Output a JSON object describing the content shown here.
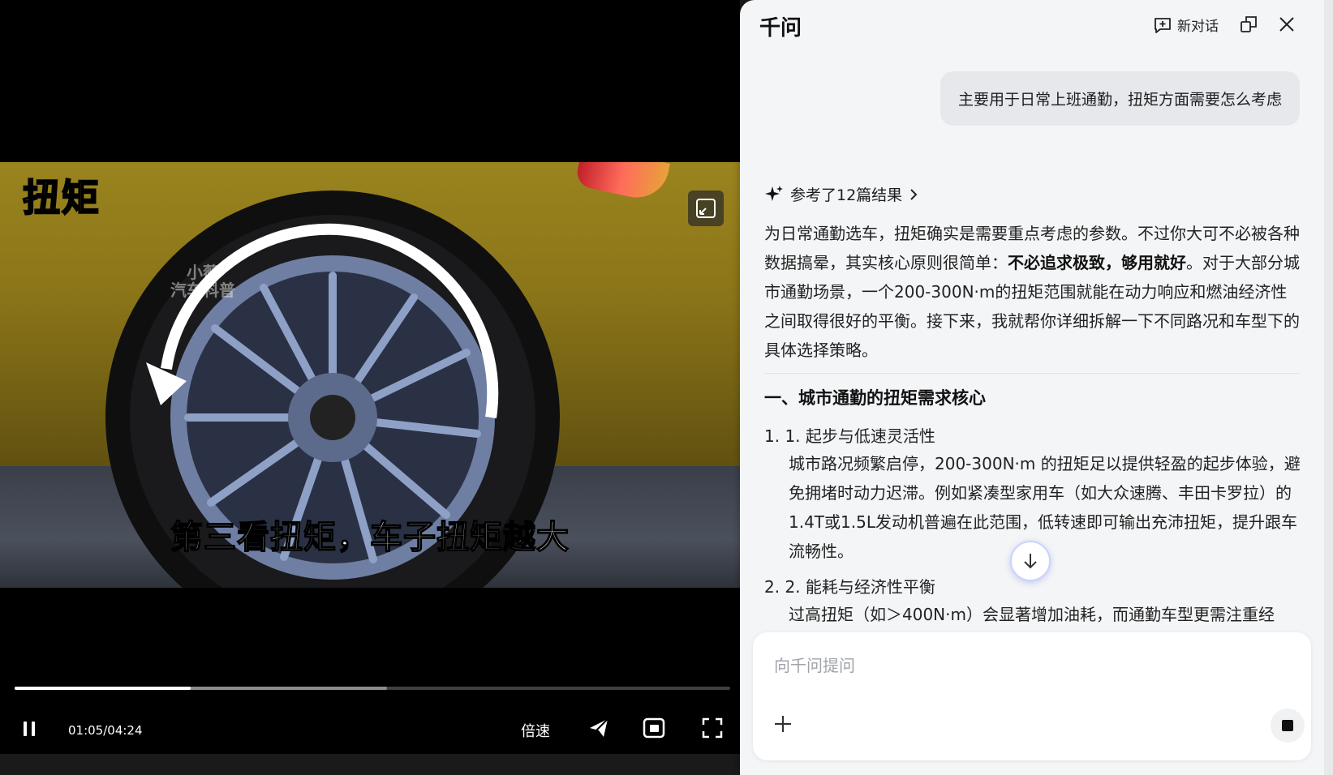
{
  "video": {
    "overlay_tag": "扭矩",
    "watermark_line1": "小薇",
    "watermark_line2": "汽车科普",
    "subtitle": "第三看扭矩，车子扭矩越大",
    "time_display": "01:05/04:24",
    "speed_label": "倍速",
    "played_fraction": 0.246,
    "loaded_fraction": 0.52,
    "icons": [
      "pause-icon",
      "share-icon",
      "mini-player-icon",
      "fullscreen-icon",
      "pip-expand-icon"
    ]
  },
  "chat": {
    "app_title": "千问",
    "new_chat_label": "新对话",
    "user_message": "主要用于日常上班通勤，扭矩方面需要怎么考虑",
    "refs_label": "参考了12篇结果",
    "answer": {
      "p1_a": "为日常通勤选车，扭矩确实是需要重点考虑的参数。不过你大可不必被各种数据搞晕，其实核心原则很简单：",
      "p1_bold": "不必追求极致，够用就好",
      "p1_b": "。对于大部分城市通勤场景，一个200-300N·m的扭矩范围就能在动力响应和燃油经济性之间取得很好的平衡。接下来，我就帮你详细拆解一下不同路况和车型下的具体选择策略。"
    },
    "section_title": "一、城市通勤的扭矩需求核心",
    "items": [
      {
        "title": "1. 1. 起步与低速灵活性",
        "body": "城市路况频繁启停，200-300N·m 的扭矩足以提供轻盈的起步体验，避免拥堵时动力迟滞。例如紧凑型家用车（如大众速腾、丰田卡罗拉）的1.4T或1.5L发动机普遍在此范围，低转速即可输出充沛扭矩，提升跟车流畅性。"
      },
      {
        "title": "2. 2. 能耗与经济性平衡",
        "body": "过高扭矩（如＞400N·m）会显著增加油耗，而通勤车型更需注重经"
      }
    ],
    "input_placeholder": "向千问提问"
  }
}
